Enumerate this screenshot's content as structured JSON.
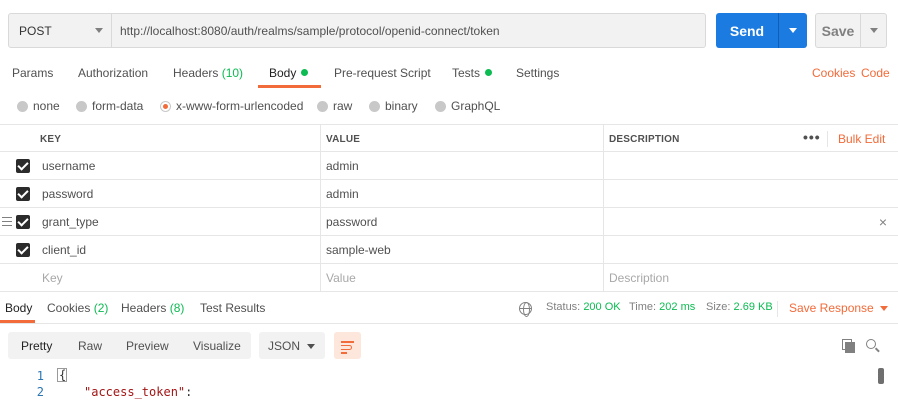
{
  "request": {
    "method": "POST",
    "url": "http://localhost:8080/auth/realms/sample/protocol/openid-connect/token",
    "send_label": "Send",
    "save_label": "Save"
  },
  "request_tabs": {
    "params": "Params",
    "authorization": "Authorization",
    "headers_label": "Headers",
    "headers_count": "(10)",
    "body": "Body",
    "prerequest": "Pre-request Script",
    "tests": "Tests",
    "settings": "Settings",
    "cookies": "Cookies",
    "code": "Code"
  },
  "body_types": {
    "none": "none",
    "form_data": "form-data",
    "urlencoded": "x-www-form-urlencoded",
    "raw": "raw",
    "binary": "binary",
    "graphql": "GraphQL",
    "selected": "x-www-form-urlencoded"
  },
  "params_table": {
    "headers": {
      "key": "KEY",
      "value": "VALUE",
      "description": "DESCRIPTION",
      "bulk_edit": "Bulk Edit",
      "more": "•••"
    },
    "rows": [
      {
        "key": "username",
        "value": "admin",
        "description": "",
        "checked": true
      },
      {
        "key": "password",
        "value": "admin",
        "description": "",
        "checked": true
      },
      {
        "key": "grant_type",
        "value": "password",
        "description": "",
        "checked": true
      },
      {
        "key": "client_id",
        "value": "sample-web",
        "description": "",
        "checked": true
      }
    ],
    "placeholder": {
      "key": "Key",
      "value": "Value",
      "description": "Description"
    },
    "delete_icon": "×"
  },
  "response_tabs": {
    "body": "Body",
    "cookies_label": "Cookies",
    "cookies_count": "(2)",
    "headers_label": "Headers",
    "headers_count": "(8)",
    "test_results": "Test Results"
  },
  "response_status": {
    "status_label": "Status:",
    "status_value": "200 OK",
    "time_label": "Time:",
    "time_value": "202 ms",
    "size_label": "Size:",
    "size_value": "2.69 KB",
    "save_response": "Save Response"
  },
  "response_view": {
    "modes": [
      "Pretty",
      "Raw",
      "Preview",
      "Visualize"
    ],
    "format": "JSON"
  },
  "code": {
    "line1_num": "1",
    "line1_text": "{",
    "line2_num": "2",
    "line2_key": "\"access_token\"",
    "line2_colon": ":"
  },
  "colors": {
    "accent": "#f26b3a",
    "send_blue": "#1b7be0",
    "success_green": "#0cbb52"
  }
}
